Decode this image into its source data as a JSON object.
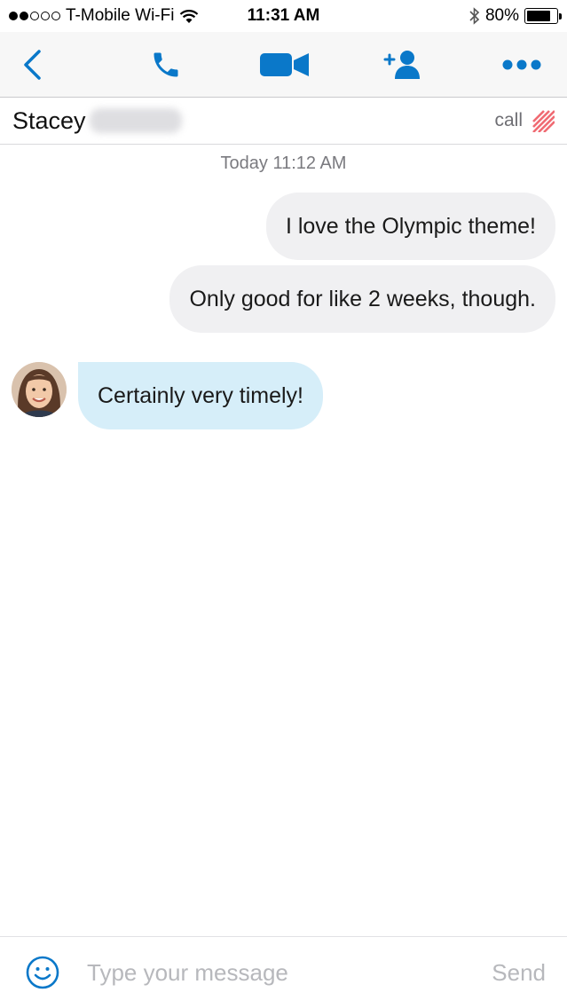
{
  "status_bar": {
    "carrier": "T-Mobile Wi-Fi",
    "time": "11:31 AM",
    "battery": "80%",
    "battery_level": 0.8,
    "icons": [
      "signal-dots-icon",
      "wifi-icon",
      "bluetooth-icon",
      "battery-icon"
    ]
  },
  "toolbar": {
    "icons": [
      "back-chevron-icon",
      "phone-icon",
      "video-camera-icon",
      "add-person-icon",
      "more-dots-icon"
    ],
    "accent_color": "#0a78c9"
  },
  "contact": {
    "first_name": "Stacey",
    "status": "call",
    "status_icon": "call-stripes-icon",
    "status_color": "#f06b73"
  },
  "chat": {
    "timestamp": "Today 11:12 AM",
    "messages": [
      {
        "direction": "outgoing",
        "text": "I love the Olympic theme!"
      },
      {
        "direction": "outgoing",
        "text": "Only good for like 2 weeks, though."
      },
      {
        "direction": "incoming",
        "text": "Certainly very timely!"
      }
    ],
    "incoming_bubble_color": "#d6eef9",
    "outgoing_bubble_color": "#f0f0f2"
  },
  "composer": {
    "placeholder": "Type your message",
    "send_label": "Send",
    "emoji_icon": "smiley-icon"
  }
}
